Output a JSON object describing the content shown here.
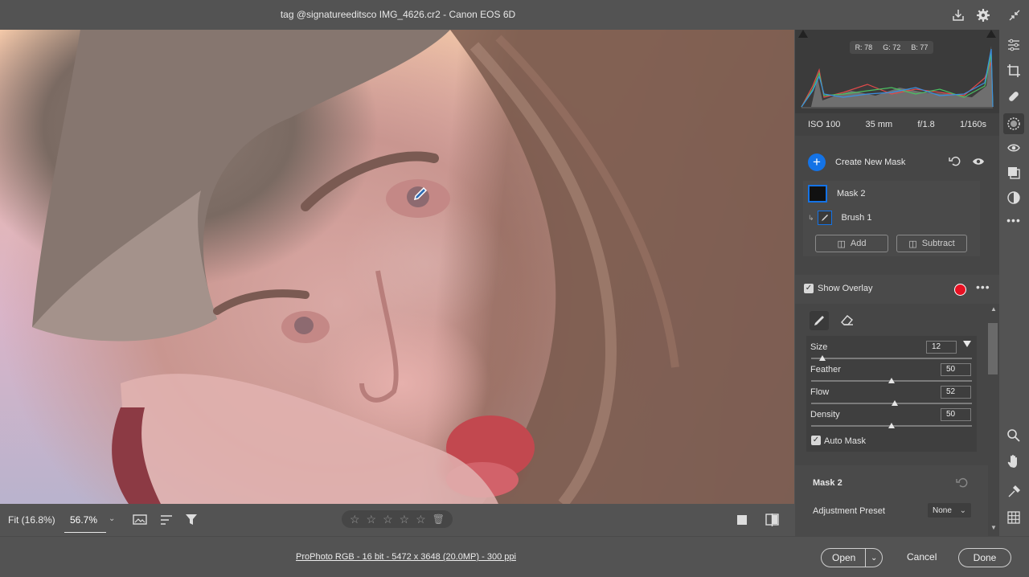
{
  "titlebar": {
    "title": "tag @signatureeditsco IMG_4626.cr2  -  Canon EOS 6D",
    "icons": [
      "save-icon",
      "gear-icon",
      "collapse-icon"
    ]
  },
  "histogram": {
    "r_label": "R: 78",
    "g_label": "G: 72",
    "b_label": "B: 77"
  },
  "exif": {
    "iso": "ISO 100",
    "focal": "35 mm",
    "aperture": "f/1.8",
    "shutter": "1/160s"
  },
  "masks": {
    "create_label": "Create New Mask",
    "mask_name": "Mask 2",
    "brush_name": "Brush 1",
    "add_label": "Add",
    "subtract_label": "Subtract",
    "show_overlay_label": "Show Overlay",
    "overlay_color": "#e81123"
  },
  "brush": {
    "size_label": "Size",
    "size_value": "12",
    "size_frac": 0.07,
    "feather_label": "Feather",
    "feather_value": "50",
    "feather_frac": 0.5,
    "flow_label": "Flow",
    "flow_value": "52",
    "flow_frac": 0.52,
    "density_label": "Density",
    "density_value": "50",
    "density_frac": 0.5,
    "auto_mask_label": "Auto Mask"
  },
  "adjust": {
    "section_title": "Mask 2",
    "preset_label": "Adjustment Preset",
    "preset_value": "None"
  },
  "viewbar": {
    "fit_label": "Fit (16.8%)",
    "zoom_label": "56.7%"
  },
  "statusbar": {
    "file_info": "ProPhoto RGB - 16 bit - 5472 x 3648 (20.0MP) - 300 ppi",
    "open_label": "Open",
    "cancel_label": "Cancel",
    "done_label": "Done"
  },
  "colors": {
    "accent_blue": "#1473e6",
    "panel_bg": "#464646",
    "app_bg": "#535353"
  }
}
